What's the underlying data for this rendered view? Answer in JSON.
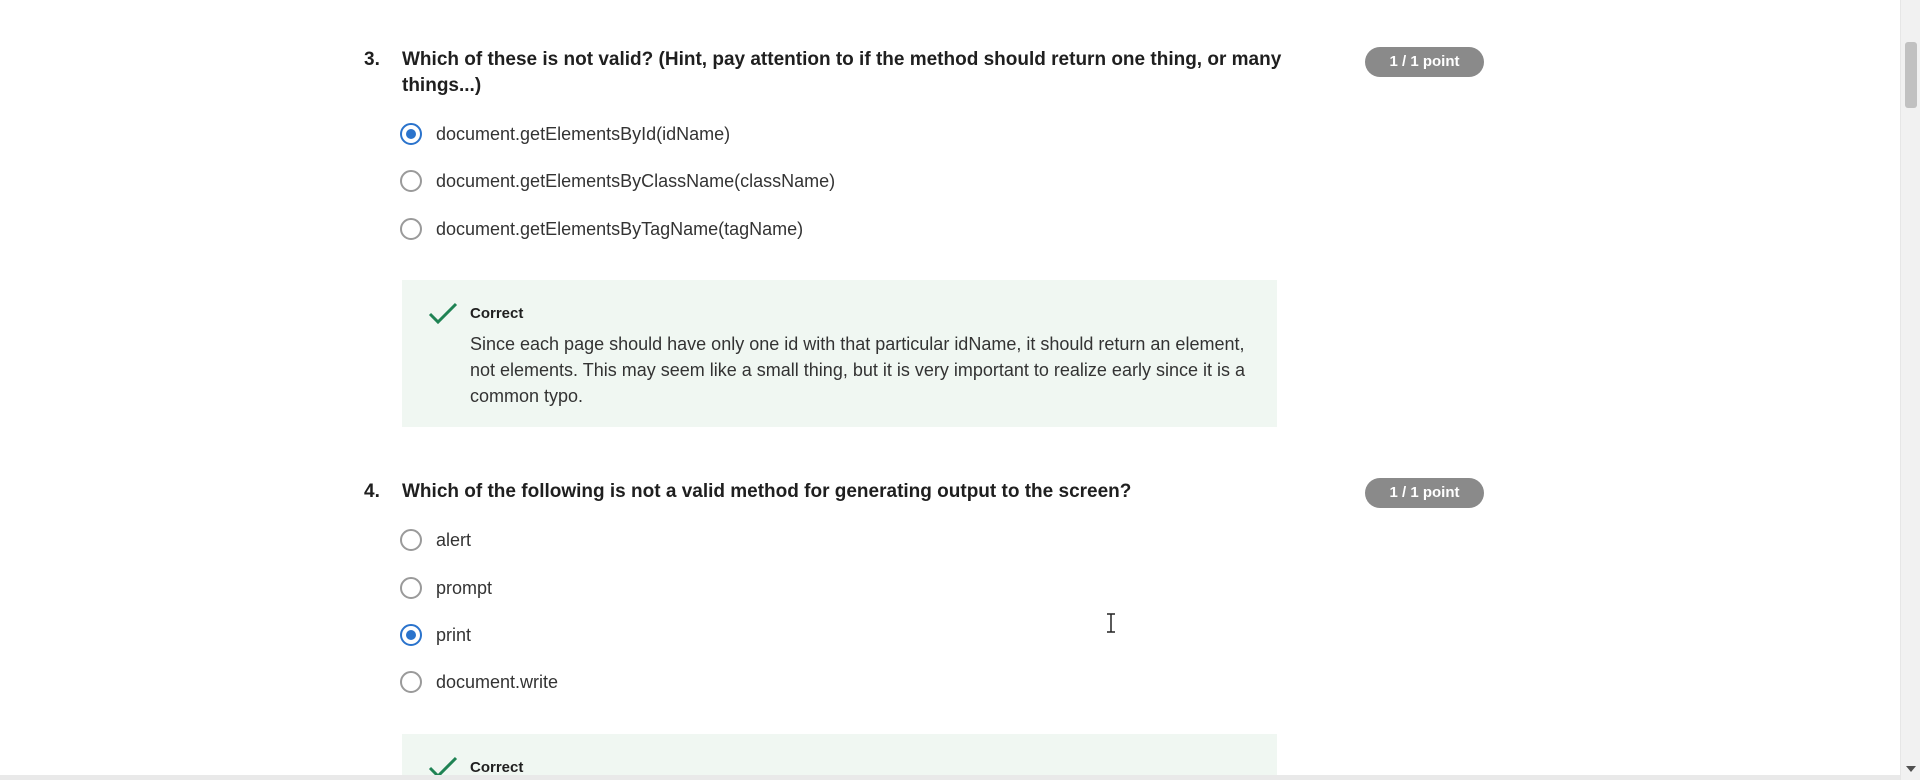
{
  "questions": [
    {
      "number": "3.",
      "text": "Which of these is not valid? (Hint, pay attention to if the method should return one thing, or many things...)",
      "points": "1 / 1 point",
      "options": [
        {
          "label": "document.getElementsById(idName)",
          "selected": true
        },
        {
          "label": "document.getElementsByClassName(className)",
          "selected": false
        },
        {
          "label": "document.getElementsByTagName(tagName)",
          "selected": false
        }
      ],
      "feedback": {
        "title": "Correct",
        "text": "Since each page should have only one id with that particular idName, it should return an element, not elements. This may seem like a small thing, but it is very important to realize early since it is a common typo."
      }
    },
    {
      "number": "4.",
      "text": "Which of the following is not a valid method for generating output to the screen?",
      "points": "1 / 1 point",
      "options": [
        {
          "label": "alert",
          "selected": false
        },
        {
          "label": "prompt",
          "selected": false
        },
        {
          "label": "print",
          "selected": true
        },
        {
          "label": "document.write",
          "selected": false
        }
      ],
      "feedback": {
        "title": "Correct"
      }
    }
  ],
  "colors": {
    "accent": "#2a73cc",
    "correct_green": "#1f8354",
    "feedback_bg": "#f0f7f2",
    "badge_bg": "#8a8a8a"
  },
  "icons": {
    "check": "check-icon",
    "cursor": "text-cursor-icon"
  }
}
